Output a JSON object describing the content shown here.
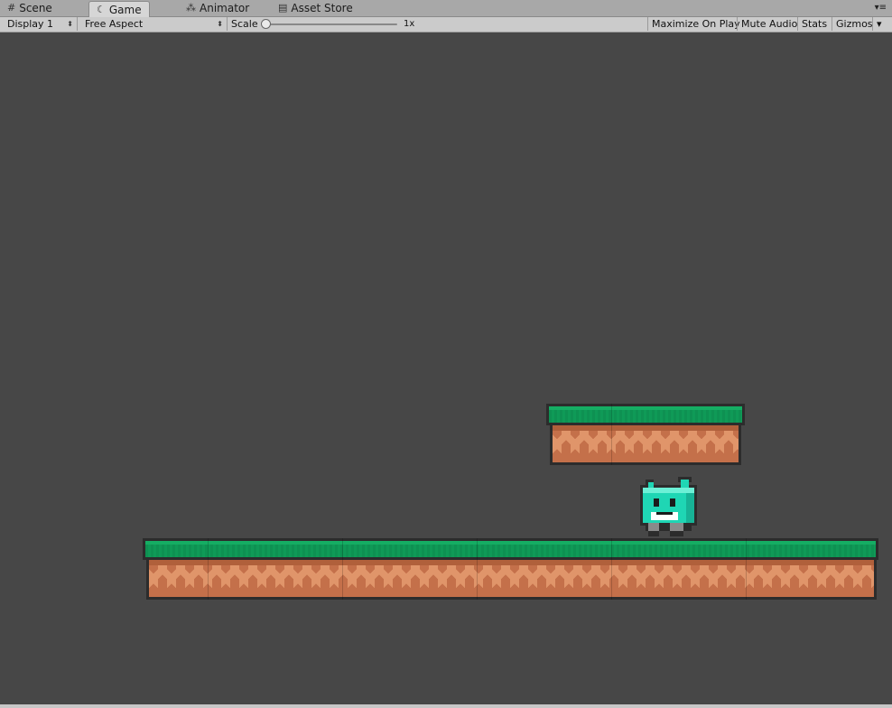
{
  "tabs": [
    {
      "label": "Scene",
      "icon": "grid-icon",
      "active": false
    },
    {
      "label": "Game",
      "icon": "game-controller-icon",
      "active": true
    },
    {
      "label": "Animator",
      "icon": "animator-icon",
      "active": false
    },
    {
      "label": "Asset Store",
      "icon": "store-bag-icon",
      "active": false
    }
  ],
  "toolbar": {
    "display": "Display 1",
    "aspect": "Free Aspect",
    "scale_label": "Scale",
    "scale_value": "1x",
    "maximize_on_play": "Maximize On Play",
    "mute_audio": "Mute Audio",
    "stats": "Stats",
    "gizmos": "Gizmos"
  },
  "colors": {
    "viewport_bg": "#474747",
    "grass": "#0f9a57",
    "dirt": "#c4704a",
    "dirt_pattern": "#e0956a",
    "hero": "#1fd6b4",
    "outline": "#2c2c2c"
  }
}
